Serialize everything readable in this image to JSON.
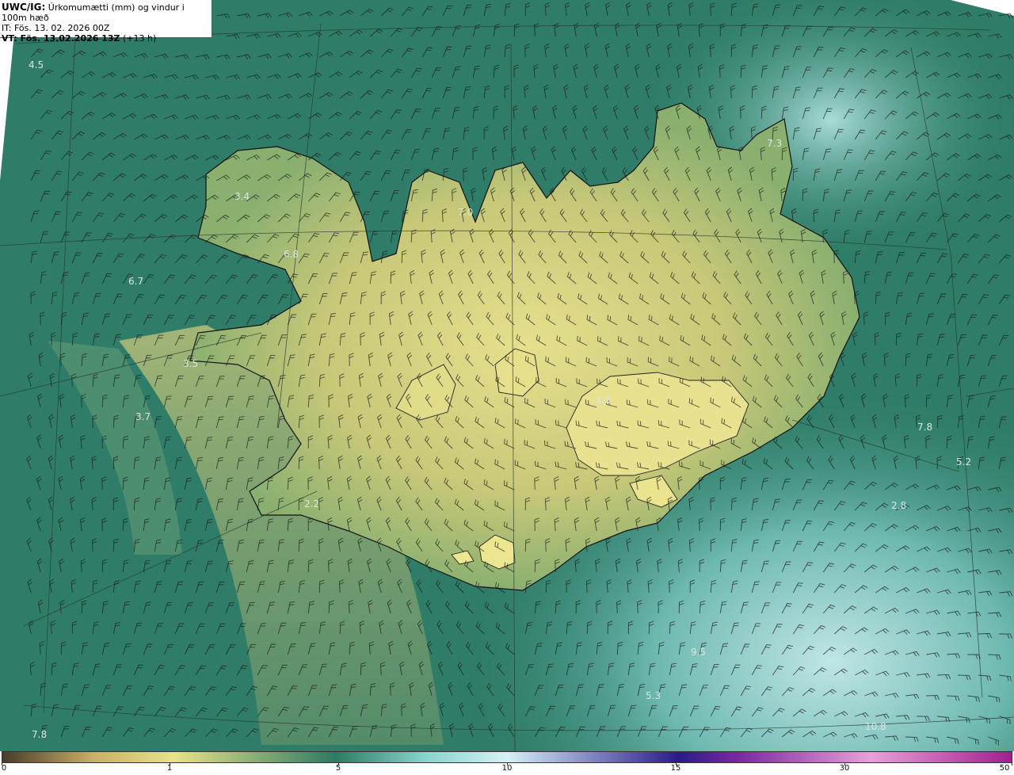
{
  "header": {
    "model_label": "UWC/IG:",
    "title_text": "Úrkomumætti (mm) og vindur i 100m hæð",
    "it_line": "IT: Fös. 13. 02. 2026 00Z",
    "vt_label": "VT: Fös. 13.02.2026 13Z",
    "vt_suffix": "(+13 h)"
  },
  "map_values": [
    "4.5",
    "7.3",
    "3.4",
    "7.0",
    "6.7",
    "6.8",
    "3.5",
    "3.7",
    "1.0",
    "7.8",
    "5.2",
    "2.8",
    "2.2",
    "9.5",
    "5.3",
    "7.8",
    "10.8"
  ],
  "colorbar": {
    "ticks": [
      "0",
      "1",
      "5",
      "10",
      "15",
      "30",
      "50"
    ],
    "stops": [
      "#4a3a2a",
      "#c8b068",
      "#e8e28a",
      "#2f7a62",
      "#8ad4d0",
      "#d6f0f6",
      "#2a1a8a",
      "#7a2aa0",
      "#e8a0d8",
      "#a02090"
    ]
  },
  "colors": {
    "ocean": "#2f7d68",
    "land_mid": "#7aa86a",
    "land_dry": "#d8d486",
    "coast": "#111111"
  }
}
